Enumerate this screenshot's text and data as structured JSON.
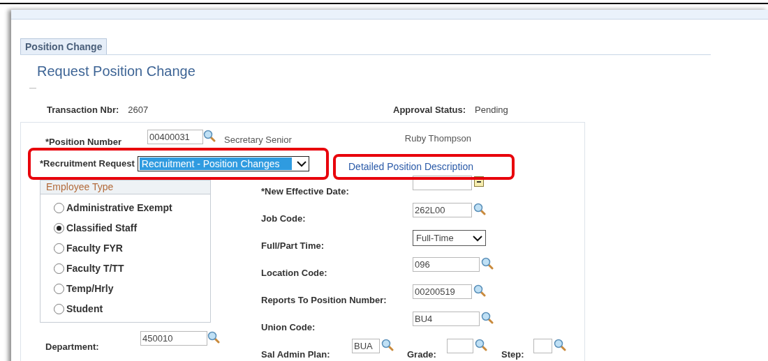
{
  "tab": {
    "label": "Position Change",
    "selected": true
  },
  "title": "Request Position Change",
  "transaction": {
    "label": "Transaction Nbr:",
    "value": "2607"
  },
  "approval": {
    "label": "Approval Status:",
    "value": "Pending"
  },
  "position": {
    "label": "*Position Number",
    "value": "00400031",
    "description": "Secretary Senior",
    "name": "Ruby Thompson"
  },
  "recruitment": {
    "label": "*Recruitment Request",
    "value": "Recruitment - Position Changes",
    "highlighted": true
  },
  "link": {
    "label": "Detailed Position Description",
    "highlighted": true
  },
  "employee_type": {
    "title": "Employee Type",
    "options": [
      {
        "label": "Administrative Exempt",
        "selected": false
      },
      {
        "label": "Classified Staff",
        "selected": true
      },
      {
        "label": "Faculty FYR",
        "selected": false
      },
      {
        "label": "Faculty T/TT",
        "selected": false
      },
      {
        "label": "Temp/Hrly",
        "selected": false
      },
      {
        "label": "Student",
        "selected": false
      }
    ]
  },
  "department": {
    "label": "Department:",
    "value": "450010"
  },
  "fields": [
    {
      "kind": "date",
      "label": "*New Effective Date:"
    },
    {
      "kind": "lookup",
      "label": "Job Code:",
      "value": "262L00"
    },
    {
      "kind": "select",
      "label": "Full/Part Time:",
      "value": "Full-Time"
    },
    {
      "kind": "lookup",
      "label": "Location Code:",
      "value": "096"
    },
    {
      "kind": "lookup",
      "label": "Reports To Position Number:",
      "value": "00200519"
    },
    {
      "kind": "lookup",
      "label": "Union Code:",
      "value": "BU4"
    }
  ],
  "salary": [
    {
      "label": "Sal Admin Plan:",
      "value": "BUA"
    },
    {
      "label": "Grade:"
    },
    {
      "label": "Step:"
    }
  ]
}
